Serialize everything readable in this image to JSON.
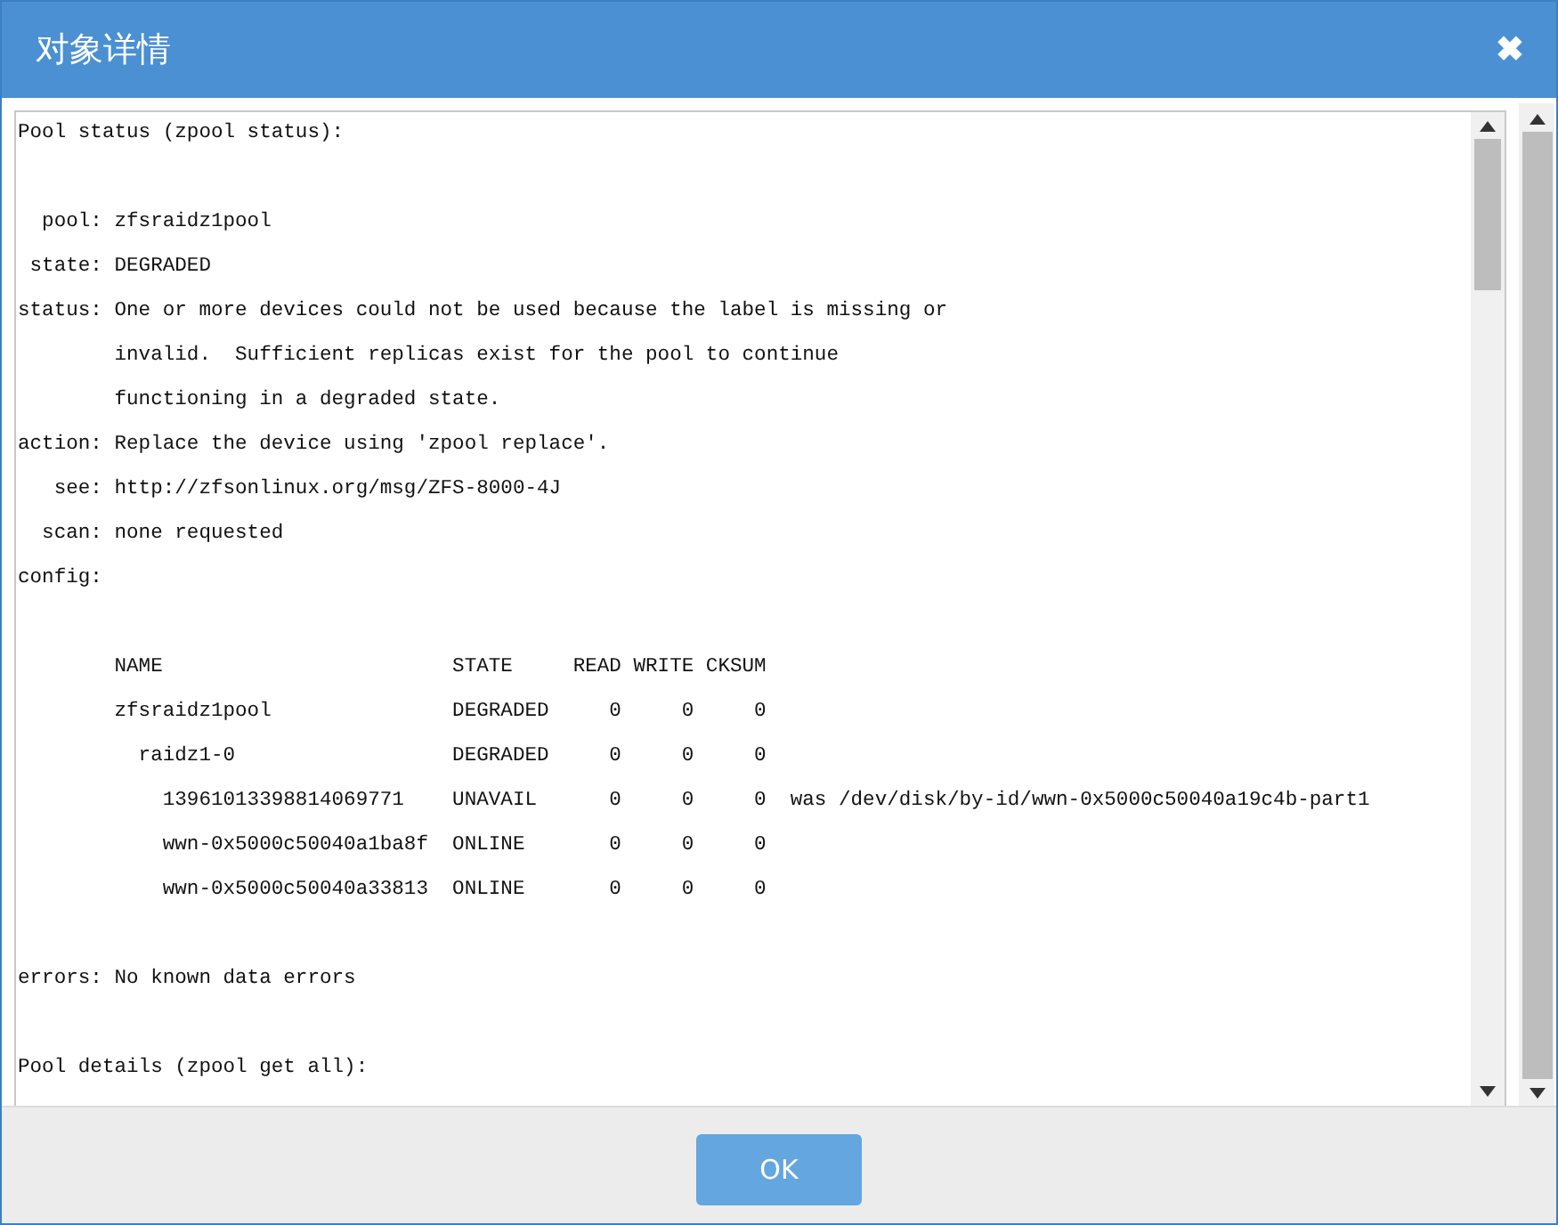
{
  "window": {
    "title": "对象详情",
    "close": "✖"
  },
  "output": {
    "blocks": [
      [
        "Pool status (zpool status):"
      ],
      [
        "  pool: zfsraidz1pool",
        " state: DEGRADED",
        "status: One or more devices could not be used because the label is missing or",
        "        invalid.  Sufficient replicas exist for the pool to continue",
        "        functioning in a degraded state.",
        "action: Replace the device using 'zpool replace'.",
        "   see: http://zfsonlinux.org/msg/ZFS-8000-4J",
        "  scan: none requested",
        "config:"
      ],
      [
        "        NAME                        STATE     READ WRITE CKSUM",
        "        zfsraidz1pool               DEGRADED     0     0     0",
        "          raidz1-0                  DEGRADED     0     0     0",
        "            13961013398814069771    UNAVAIL      0     0     0  was /dev/disk/by-id/wwn-0x5000c50040a19c4b-part1",
        "            wwn-0x5000c50040a1ba8f  ONLINE       0     0     0",
        "            wwn-0x5000c50040a33813  ONLINE       0     0     0"
      ],
      [
        "errors: No known data errors"
      ],
      [
        "Pool details (zpool get all):"
      ]
    ]
  },
  "buttons": [
    "OK"
  ]
}
